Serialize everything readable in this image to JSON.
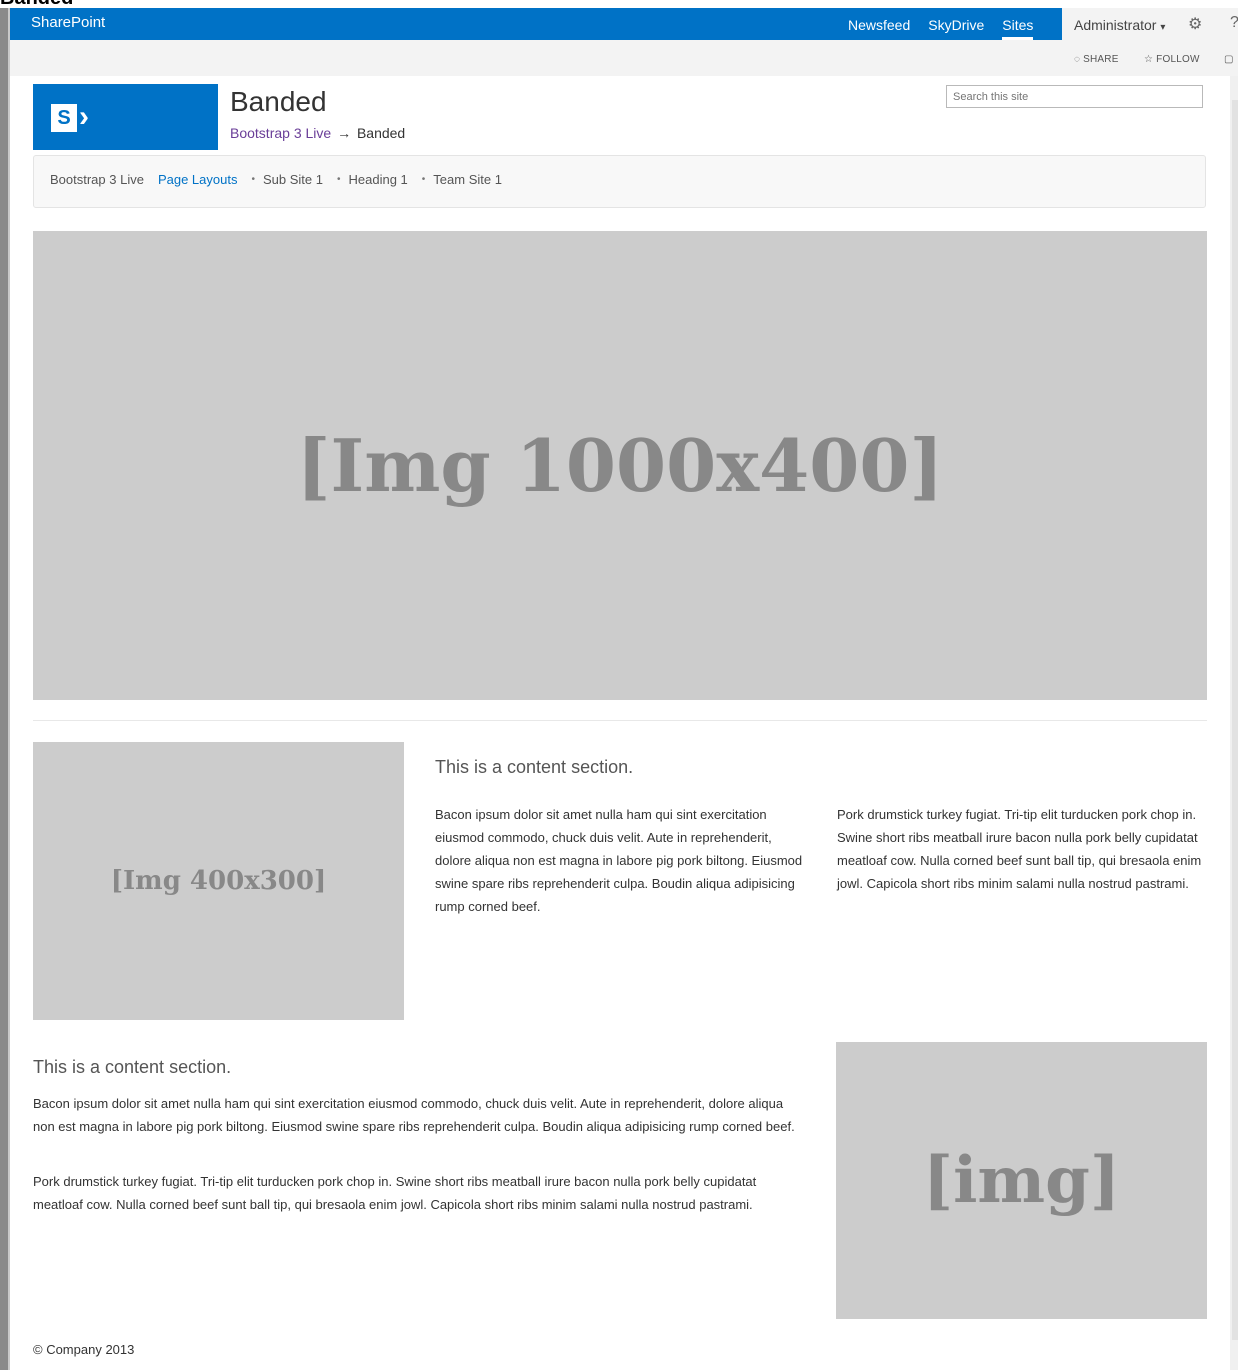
{
  "page_heading": "Banded",
  "suitebar": {
    "brand": "SharePoint",
    "links": [
      "Newsfeed",
      "SkyDrive",
      "Sites"
    ],
    "user": "Administrator",
    "caret": "▾",
    "gear_glyph": "⚙",
    "help_glyph": "?"
  },
  "ribbon": {
    "share": "SHARE",
    "follow": "FOLLOW",
    "share_icon": "◌",
    "follow_icon": "☆",
    "focus_icon": "▢"
  },
  "site": {
    "logo_letter": "S",
    "logo_mark": "›",
    "title": "Banded",
    "breadcrumb_parent": "Bootstrap 3 Live",
    "breadcrumb_arrow": "→",
    "breadcrumb_current": "Banded",
    "search_placeholder": "Search this site"
  },
  "nav": {
    "items": [
      "Bootstrap 3 Live",
      "Page Layouts",
      "Sub Site 1",
      "Heading 1",
      "Team Site 1"
    ],
    "bullet": "•"
  },
  "hero": {
    "label": "[Img 1000x400]"
  },
  "section1": {
    "image_label": "[Img 400x300]",
    "title": "This is a content section.",
    "col1": "Bacon ipsum dolor sit amet nulla ham qui sint exercitation eiusmod commodo, chuck duis velit. Aute in reprehenderit, dolore aliqua non est magna in labore pig pork biltong. Eiusmod swine spare ribs reprehenderit culpa. Boudin aliqua adipisicing rump corned beef.",
    "col2": "Pork drumstick turkey fugiat. Tri-tip elit turducken pork chop in. Swine short ribs meatball irure bacon nulla pork belly cupidatat meatloaf cow. Nulla corned beef sunt ball tip, qui bresaola enim jowl. Capicola short ribs minim salami nulla nostrud pastrami."
  },
  "section2": {
    "title": "This is a content section.",
    "para1": "Bacon ipsum dolor sit amet nulla ham qui sint exercitation eiusmod commodo, chuck duis velit. Aute in reprehenderit, dolore aliqua non est magna in labore pig pork biltong. Eiusmod swine spare ribs reprehenderit culpa. Boudin aliqua adipisicing rump corned beef.",
    "para2": "Pork drumstick turkey fugiat. Tri-tip elit turducken pork chop in. Swine short ribs meatball irure bacon nulla pork belly cupidatat meatloaf cow. Nulla corned beef sunt ball tip, qui bresaola enim jowl. Capicola short ribs minim salami nulla nostrud pastrami.",
    "image_label": "[img]"
  },
  "footer": "© Company 2013"
}
